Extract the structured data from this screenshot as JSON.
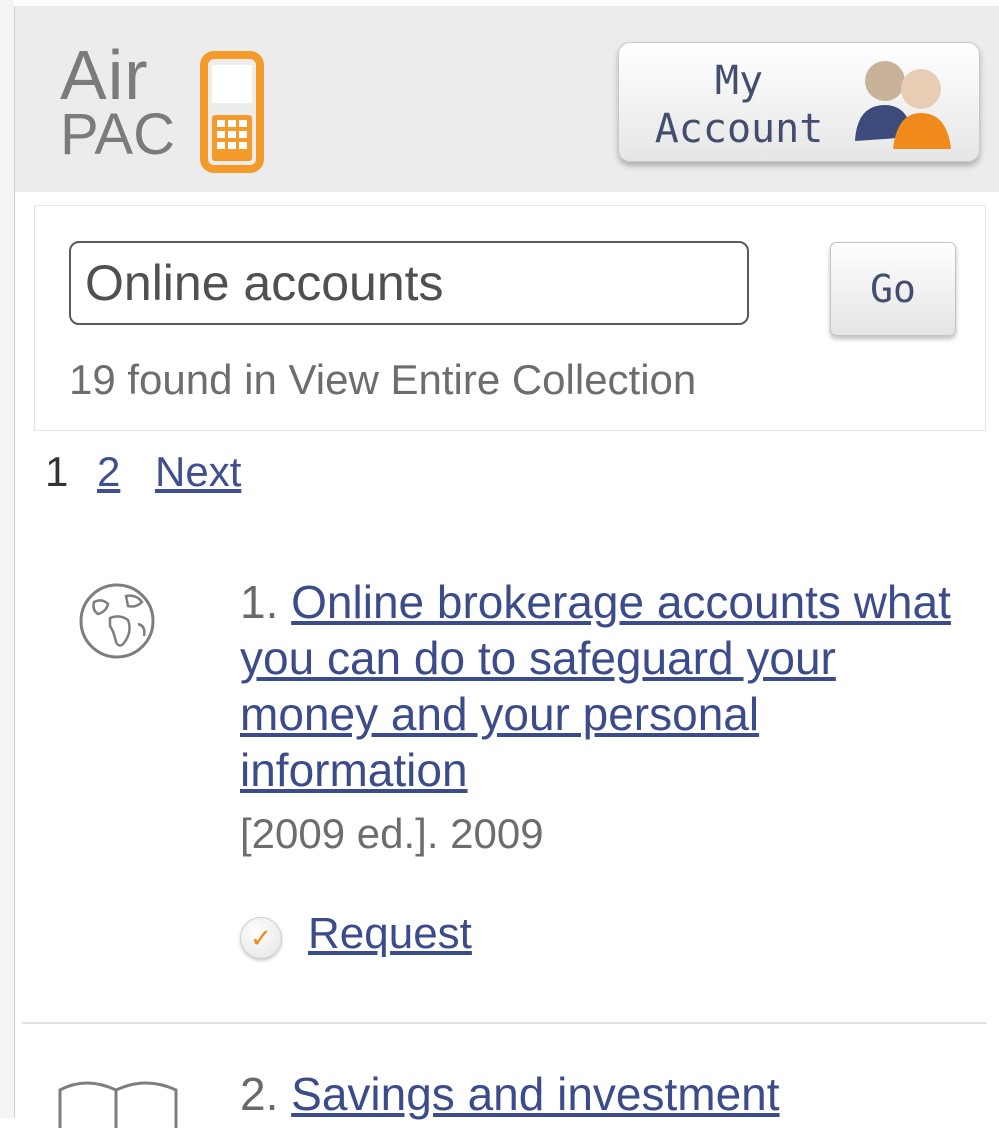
{
  "header": {
    "logo_top": "Air",
    "logo_bottom": "PAC",
    "account_line1": "My",
    "account_line2": "Account",
    "colors": {
      "header_bg": "#ececec",
      "logo_gray": "#7b7b7b",
      "logo_orange": "#f39a2b",
      "link": "#3c4b8a"
    }
  },
  "search": {
    "value": "Online accounts",
    "go_label": "Go",
    "found_text": "19 found in View Entire Collection"
  },
  "pager": {
    "current": "1",
    "page2": "2",
    "next": "Next"
  },
  "results": [
    {
      "number": "1.",
      "title": "Online brokerage accounts what you can do to safeguard your money and your personal information",
      "meta": "[2009 ed.]. 2009",
      "request_label": "Request",
      "icon": "globe-icon"
    },
    {
      "number": "2.",
      "title": "Savings and investment",
      "icon": "book-icon"
    }
  ]
}
